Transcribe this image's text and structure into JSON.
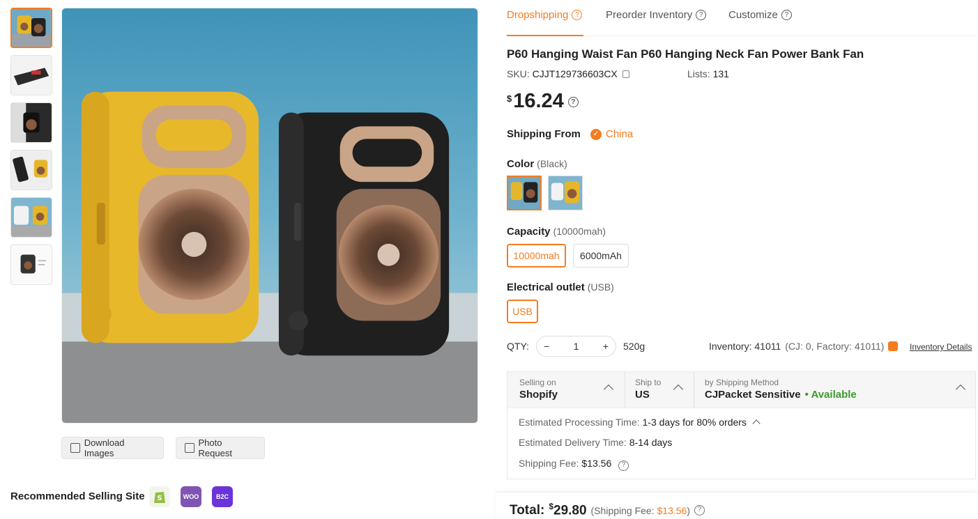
{
  "gallery": {
    "thumbs": [
      "thumb-yellow-black-fans",
      "thumb-fan-side",
      "thumb-fan-dark",
      "thumb-fan-phone-charging",
      "thumb-fan-pair",
      "thumb-fan-white"
    ],
    "download_images": "Download Images",
    "photo_request": "Photo Request"
  },
  "recommended": {
    "title": "Recommended Selling Site",
    "platforms": [
      "shopify-icon",
      "woocommerce-icon",
      "wix-icon"
    ],
    "woo_label": "WOO",
    "wix_label": "B2C"
  },
  "tabs": [
    {
      "label": "Dropshipping",
      "active": true
    },
    {
      "label": "Preorder Inventory",
      "active": false
    },
    {
      "label": "Customize",
      "active": false
    }
  ],
  "product": {
    "title": "P60 Hanging Waist Fan P60 Hanging Neck Fan Power Bank Fan",
    "sku_label": "SKU:",
    "sku": "CJJT129736603CX",
    "lists_label": "Lists:",
    "lists": "131",
    "currency": "$",
    "price": "16.24",
    "shipping_from_label": "Shipping From",
    "shipping_from": "China",
    "color_label": "Color",
    "color_selected": "(Black)",
    "capacity_label": "Capacity",
    "capacity_selected": "(10000mah)",
    "capacity_options": [
      "10000mah",
      "6000mAh"
    ],
    "outlet_label": "Electrical outlet",
    "outlet_selected": "(USB)",
    "outlet_options": [
      "USB"
    ],
    "qty_label": "QTY:",
    "qty": "1",
    "minus": "−",
    "plus": "+",
    "weight": "520g",
    "inventory": "Inventory: 41011",
    "inventory_detail": "(CJ: 0, Factory: 41011)",
    "inventory_link": "Inventory Details"
  },
  "shipping": {
    "selling_on_label": "Selling on",
    "selling_on": "Shopify",
    "ship_to_label": "Ship to",
    "ship_to": "US",
    "method_label": "by Shipping Method",
    "method": "CJPacket Sensitive",
    "availability": "• Available",
    "processing_label": "Estimated Processing Time:",
    "processing": "1-3 days for 80% orders",
    "delivery_label": "Estimated Delivery Time:",
    "delivery": "8-14 days",
    "fee_label": "Shipping Fee:",
    "fee": "$13.56"
  },
  "total": {
    "label": "Total:",
    "currency": "$",
    "amount": "29.80",
    "fee_prefix": "(Shipping Fee:",
    "fee": "$13.56",
    "fee_suffix": ")"
  },
  "colors": {
    "accent": "#f57c1f",
    "available": "#3b9a2b"
  }
}
